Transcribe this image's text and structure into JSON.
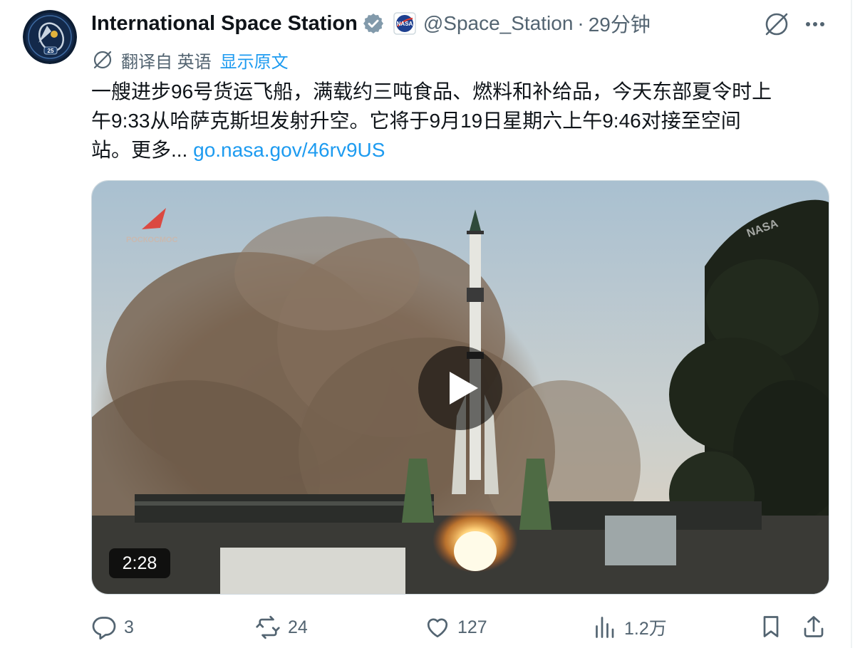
{
  "tweet": {
    "author_name": "International Space Station",
    "handle": "@Space_Station",
    "separator": "·",
    "time": "29分钟",
    "translation": {
      "label": "翻译自 英语",
      "show_original": "显示原文"
    },
    "text_line1": "一艘进步96号货运飞船，满载约三吨食品、燃料和补给品，今天东部夏令时上",
    "text_line2": "午9:33从哈萨克斯坦发射升空。它将于9月19日星期六上午9:46对接至空间",
    "text_line3": "站。更多... ",
    "link": "go.nasa.gov/46rv9US",
    "media": {
      "duration": "2:28",
      "watermark_left": "РОСКОСМОС",
      "watermark_right": "NASA",
      "avatar_badge": "25",
      "nasa_badge": "NASA"
    },
    "stats": {
      "replies": "3",
      "reposts": "24",
      "likes": "127",
      "views": "1.2万"
    }
  },
  "colors": {
    "accent": "#1d9bf0",
    "secondary_text": "#536471",
    "primary_text": "#0f1419",
    "verified_badge": "#829aab"
  },
  "icons": [
    "grok-icon",
    "more-icon",
    "translate-icon",
    "verified-icon",
    "nasa-badge-icon",
    "play-icon",
    "reply-icon",
    "repost-icon",
    "like-icon",
    "views-icon",
    "bookmark-icon",
    "share-icon"
  ]
}
